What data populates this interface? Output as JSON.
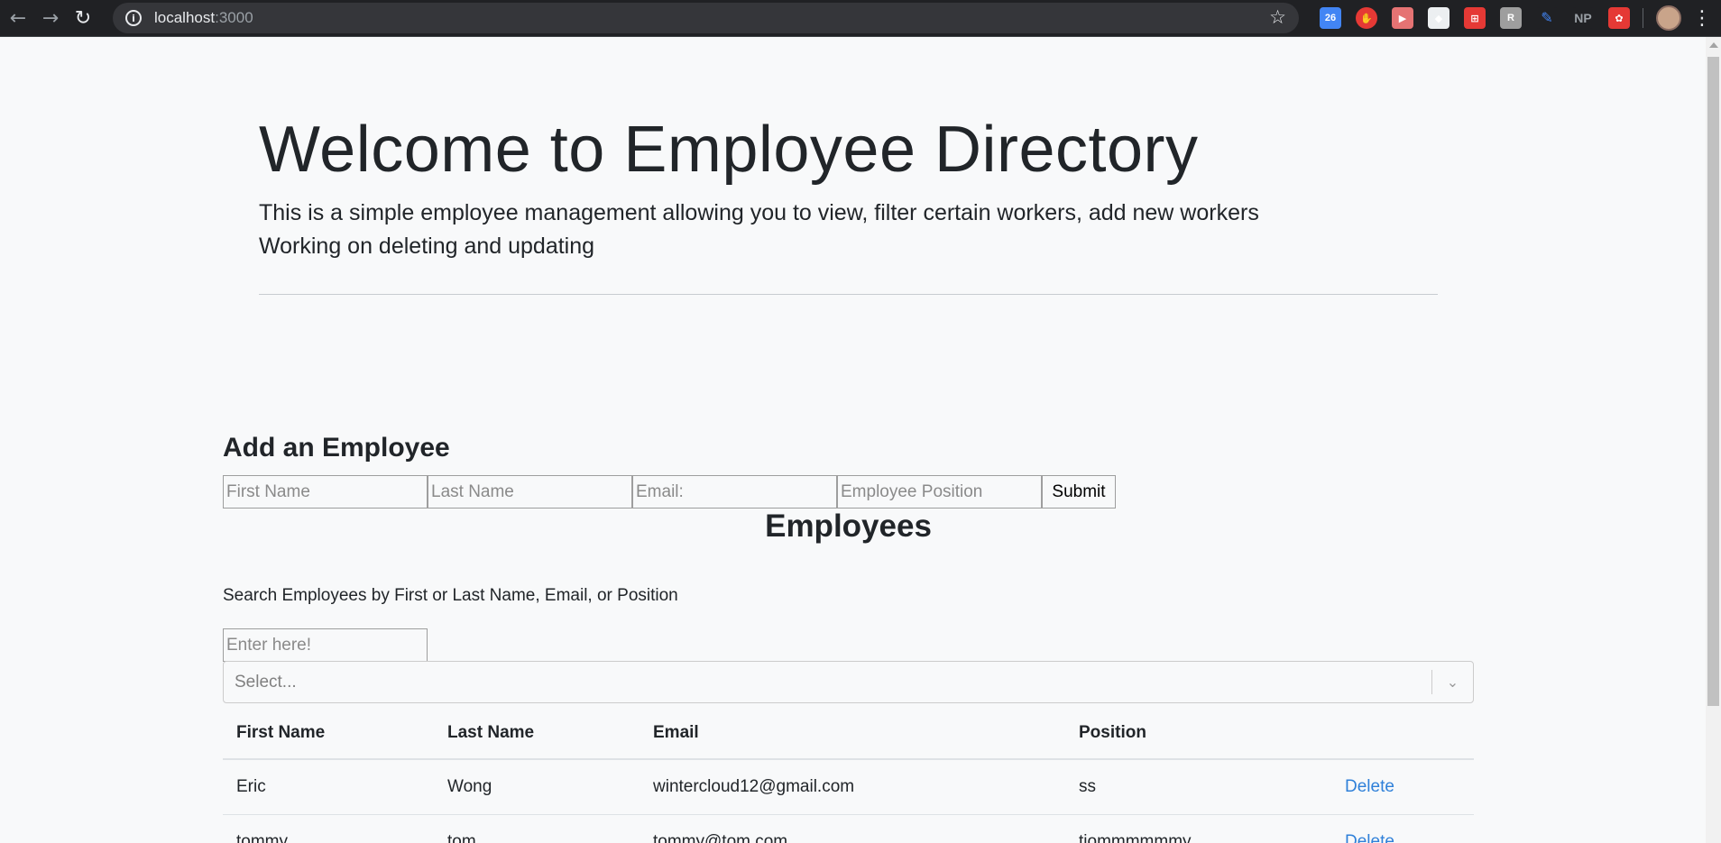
{
  "browser": {
    "url_host": "localhost",
    "url_port": ":3000",
    "extensions": [
      {
        "name": "calendar-ext-icon",
        "color": "#4285f4",
        "text": "26"
      },
      {
        "name": "stop-ext-icon",
        "color": "#e53935",
        "text": "✋"
      },
      {
        "name": "record-ext-icon",
        "color": "#e57373",
        "text": "▶"
      },
      {
        "name": "tag-ext-icon",
        "color": "#eceff1",
        "text": "◆"
      },
      {
        "name": "pdf-ext-icon",
        "color": "#e53935",
        "text": "⊞"
      },
      {
        "name": "r-ext-icon",
        "color": "#9e9e9e",
        "text": "R"
      },
      {
        "name": "pen-ext-icon",
        "color": "#202124",
        "text": "✎"
      },
      {
        "name": "np-ext-icon",
        "color": "#202124",
        "text": "NP"
      },
      {
        "name": "puzzle-ext-icon",
        "color": "#e53935",
        "text": "✿"
      }
    ]
  },
  "jumbotron": {
    "title": "Welcome to Employee Directory",
    "lead_line1": "This is a simple employee management allowing you to view, filter certain workers, add new workers",
    "lead_line2": "Working on deleting and updating"
  },
  "add_form": {
    "title": "Add an Employee",
    "first_name_placeholder": "First Name",
    "last_name_placeholder": "Last Name",
    "email_placeholder": "Email:",
    "position_placeholder": "Employee Position",
    "submit_label": "Submit"
  },
  "employees": {
    "title": "Employees",
    "search_label": "Search Employees by First or Last Name, Email, or Position",
    "search_placeholder": "Enter here!",
    "select_placeholder": "Select...",
    "columns": [
      "First Name",
      "Last Name",
      "Email",
      "Position",
      ""
    ],
    "rows": [
      {
        "first": "Eric",
        "last": "Wong",
        "email": "wintercloud12@gmail.com",
        "position": "ss",
        "action": "Delete"
      },
      {
        "first": "tommy",
        "last": "tom",
        "email": "tommy@tom.com",
        "position": "tiommmmmmy",
        "action": "Delete"
      }
    ]
  }
}
